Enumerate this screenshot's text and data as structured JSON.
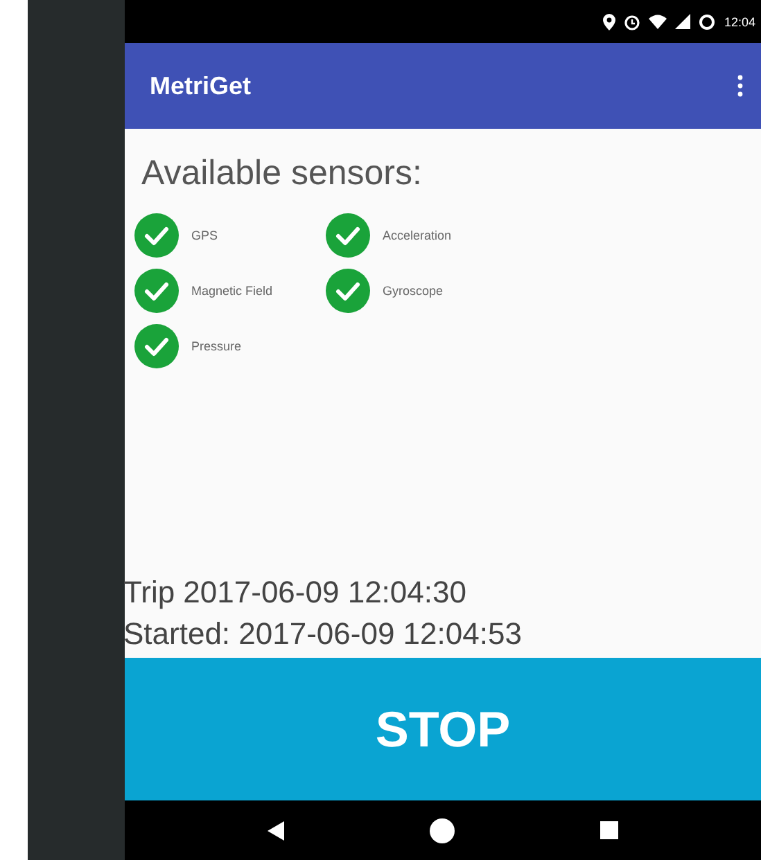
{
  "status_bar": {
    "time": "12:04"
  },
  "app_bar": {
    "title": "MetriGet"
  },
  "heading": "Available sensors:",
  "sensors": [
    {
      "name": "GPS",
      "available": true
    },
    {
      "name": "Acceleration",
      "available": true
    },
    {
      "name": "Magnetic Field",
      "available": true
    },
    {
      "name": "Gyroscope",
      "available": true
    },
    {
      "name": "Pressure",
      "available": true
    }
  ],
  "trip": "Trip 2017-06-09 12:04:30",
  "started": "Started: 2017-06-09 12:04:53",
  "stop_button": "STOP"
}
